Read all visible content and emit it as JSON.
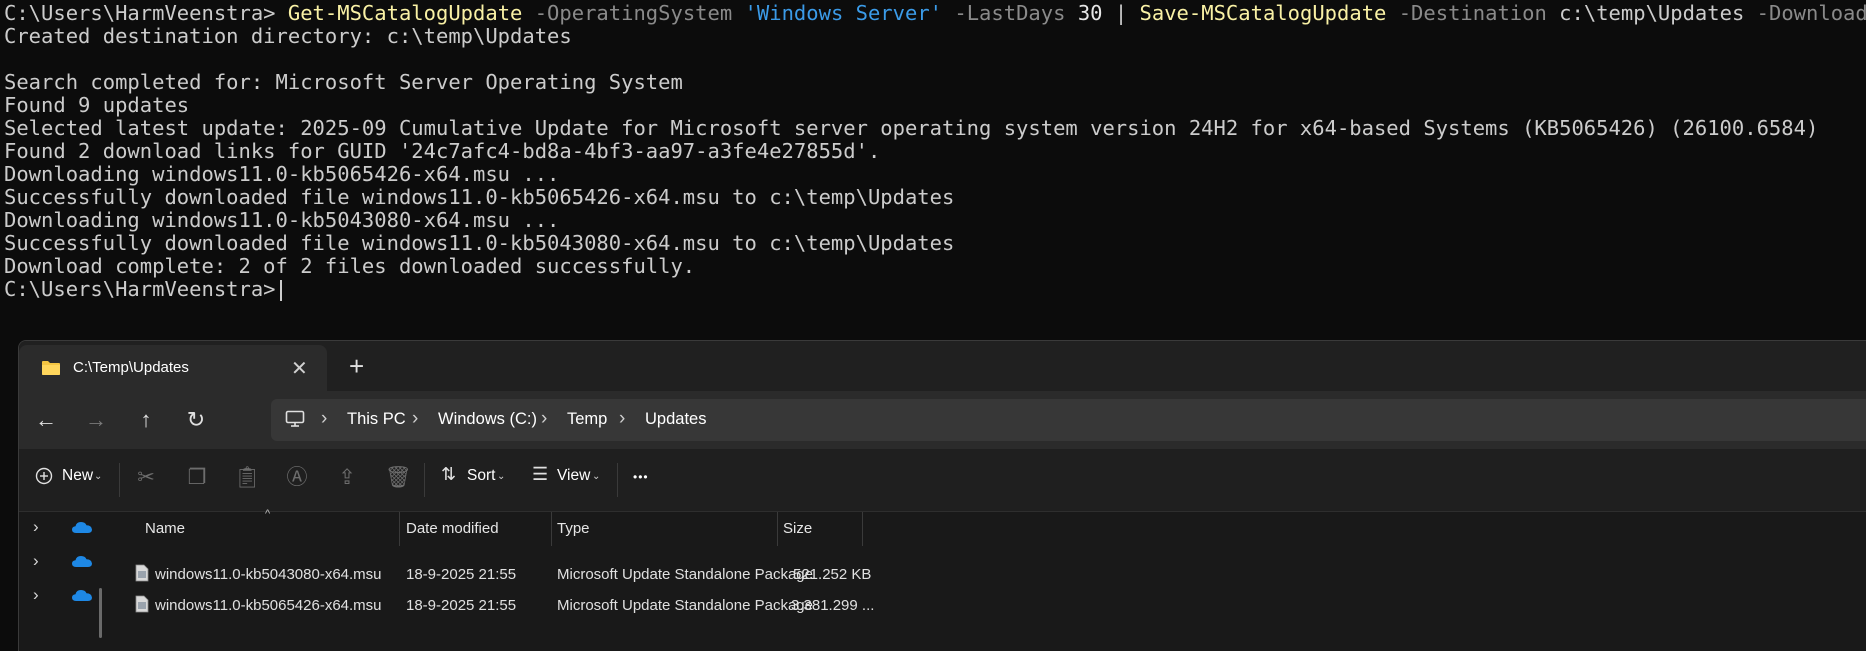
{
  "terminal": {
    "prompt": "C:\\Users\\HarmVeenstra>",
    "command": {
      "cmd1": "Get-MSCatalogUpdate",
      "p1": "-OperatingSystem",
      "v1": "'Windows Server'",
      "p2": "-LastDays",
      "v2": "30",
      "pipe": "|",
      "cmd2": "Save-MSCatalogUpdate",
      "p3": "-Destination",
      "v3": "c:\\temp\\Updates",
      "p4": "-DownloadAll"
    },
    "output": [
      "Created destination directory: c:\\temp\\Updates",
      "",
      "Search completed for: Microsoft Server Operating System",
      "Found 9 updates",
      "Selected latest update: 2025-09 Cumulative Update for Microsoft server operating system version 24H2 for x64-based Systems (KB5065426) (26100.6584)",
      "Found 2 download links for GUID '24c7afc4-bd8a-4bf3-aa97-a3fe4e27855d'.",
      "Downloading windows11.0-kb5065426-x64.msu ...",
      "Successfully downloaded file windows11.0-kb5065426-x64.msu to c:\\temp\\Updates",
      "Downloading windows11.0-kb5043080-x64.msu ...",
      "Successfully downloaded file windows11.0-kb5043080-x64.msu to c:\\temp\\Updates",
      "Download complete: 2 of 2 files downloaded successfully."
    ],
    "final_prompt": "C:\\Users\\HarmVeenstra>"
  },
  "explorer": {
    "tab_title": "C:\\Temp\\Updates",
    "tab_close": "✕",
    "new_tab": "+",
    "nav": {
      "back": "←",
      "forward": "→",
      "up": "↑",
      "refresh": "↻"
    },
    "breadcrumb": [
      "This PC",
      "Windows (C:)",
      "Temp",
      "Updates"
    ],
    "breadcrumb_sep": "›",
    "toolbar": {
      "new_label": "New",
      "sort_label": "Sort",
      "view_label": "View",
      "more": "•••"
    },
    "columns": {
      "name": "Name",
      "date": "Date modified",
      "type": "Type",
      "size": "Size"
    },
    "files": [
      {
        "name": "windows11.0-kb5043080-x64.msu",
        "date": "18-9-2025 21:55",
        "type": "Microsoft Update Standalone Package",
        "size": "521.252 KB"
      },
      {
        "name": "windows11.0-kb5065426-x64.msu",
        "date": "18-9-2025 21:55",
        "type": "Microsoft Update Standalone Package",
        "size": "3.381.299 ..."
      }
    ]
  },
  "colors": {
    "terminal_bg": "#0c0c0c",
    "cmdlet": "#f9f1a5",
    "param": "#8a8a8a",
    "string": "#3b9be8",
    "folder": "#f4c542",
    "onedrive": "#1e88e5"
  }
}
